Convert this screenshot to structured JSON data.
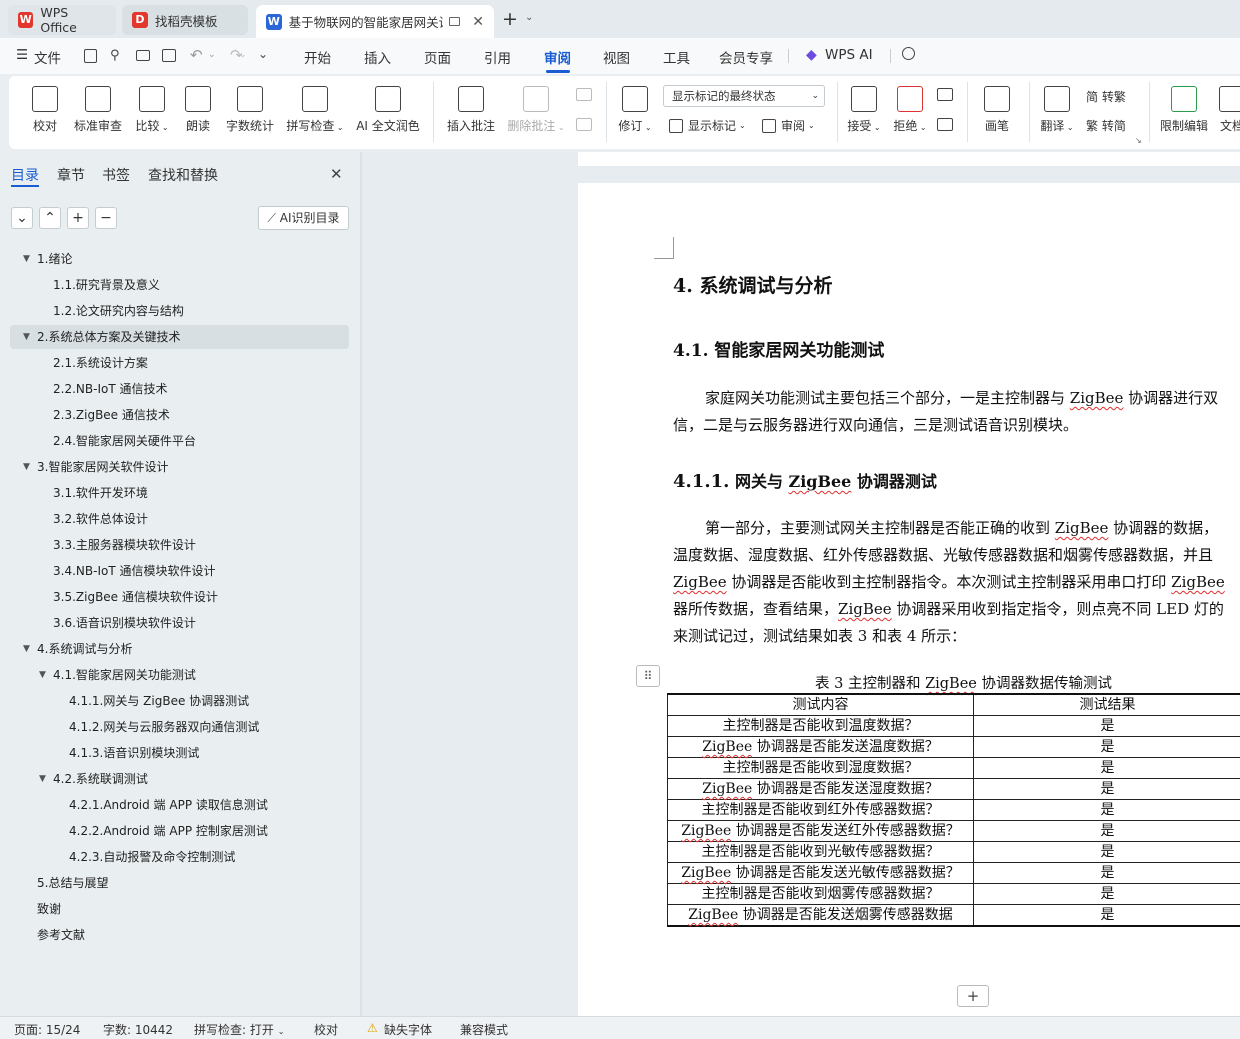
{
  "tabs": [
    {
      "label": "WPS Office",
      "icon": "wps-logo-icon"
    },
    {
      "label": "找稻壳模板",
      "icon": "docer-logo-icon"
    },
    {
      "label": "基于物联网的智能家居网关设",
      "icon": "word-doc-icon"
    }
  ],
  "menu": {
    "file": "文件",
    "items": [
      "开始",
      "插入",
      "页面",
      "引用",
      "审阅",
      "视图",
      "工具",
      "会员专享"
    ],
    "ai": "WPS AI"
  },
  "ribbon": {
    "proofread": "校对",
    "std_review": "标准审查",
    "compare": "比较",
    "read_aloud": "朗读",
    "word_count": "字数统计",
    "spell_check": "拼写检查",
    "ai_polish": "AI 全文润色",
    "insert_comment": "插入批注",
    "delete_comment": "删除批注",
    "revise": "修订",
    "markup_select": "显示标记的最终状态",
    "show_markup": "显示标记",
    "review_pane": "审阅",
    "accept": "接受",
    "reject": "拒绝",
    "pen": "画笔",
    "translate": "翻译",
    "to_trad": "简 转繁",
    "to_simp": "繁 转简",
    "restrict_edit": "限制编辑",
    "doc_rights": "文档"
  },
  "panel": {
    "tabs": [
      "目录",
      "章节",
      "书签",
      "查找和替换"
    ],
    "ai_toc": "AI识别目录",
    "toc": [
      {
        "text": "1.绪论",
        "level": 1,
        "caret": true
      },
      {
        "text": "1.1.研究背景及意义",
        "level": 2
      },
      {
        "text": "1.2.论文研究内容与结构",
        "level": 2
      },
      {
        "text": "2.系统总体方案及关键技术",
        "level": 1,
        "caret": true,
        "selected": true
      },
      {
        "text": "2.1.系统设计方案",
        "level": 2
      },
      {
        "text": "2.2.NB-IoT 通信技术",
        "level": 2
      },
      {
        "text": "2.3.ZigBee 通信技术",
        "level": 2
      },
      {
        "text": "2.4.智能家居网关硬件平台",
        "level": 2
      },
      {
        "text": "3.智能家居网关软件设计",
        "level": 1,
        "caret": true
      },
      {
        "text": "3.1.软件开发环境",
        "level": 2
      },
      {
        "text": "3.2.软件总体设计",
        "level": 2
      },
      {
        "text": "3.3.主服务器模块软件设计",
        "level": 2
      },
      {
        "text": "3.4.NB-IoT 通信模块软件设计",
        "level": 2
      },
      {
        "text": "3.5.ZigBee 通信模块软件设计",
        "level": 2
      },
      {
        "text": "3.6.语音识别模块软件设计",
        "level": 2
      },
      {
        "text": "4.系统调试与分析",
        "level": 1,
        "caret": true
      },
      {
        "text": "4.1.智能家居网关功能测试",
        "level": 2,
        "caret": true
      },
      {
        "text": "4.1.1.网关与 ZigBee 协调器测试",
        "level": 3
      },
      {
        "text": "4.1.2.网关与云服务器双向通信测试",
        "level": 3
      },
      {
        "text": "4.1.3.语音识别模块测试",
        "level": 3
      },
      {
        "text": "4.2.系统联调测试",
        "level": 2,
        "caret": true
      },
      {
        "text": "4.2.1.Android 端 APP 读取信息测试",
        "level": 3
      },
      {
        "text": "4.2.2.Android 端 APP 控制家居测试",
        "level": 3
      },
      {
        "text": "4.2.3.自动报警及命令控制测试",
        "level": 3
      },
      {
        "text": "5.总结与展望",
        "level": 1
      },
      {
        "text": "致谢",
        "level": 1
      },
      {
        "text": "参考文献",
        "level": 1
      }
    ]
  },
  "doc": {
    "h1": "4.  系统调试与分析",
    "h2": "4.1.  智能家居网关功能测试",
    "p1_l1a": "家庭网关功能测试主要包括三个部分，一是主控制器与 ",
    "zig": "ZigBee",
    "p1_l1b": " 协调器进行双",
    "p1_l2": "信，二是与云服务器进行双向通信，三是测试语音识别模块。",
    "h3_num": "4.1.1.",
    "h3_a": "网关与 ",
    "h3_b": " 协调器测试",
    "p2_l1a": "第一部分，主要测试网关主控制器是否能正确的收到 ",
    "p2_l1b": " 协调器的数据，",
    "p2_l2": "温度数据、湿度数据、红外传感器数据、光敏传感器数据和烟雾传感器数据，并且",
    "p2_l3b": "  协调器是否能收到主控制器指令。本次测试主控制器采用串口打印 ",
    "p2_l4a": "器所传数据，查看结果，",
    "p2_l4b": " 协调器采用收到指定指令，则点亮不同 LED 灯的",
    "p2_l5": "来测试记过，测试结果如表 3 和表 4 所示：",
    "caption_a": "表 3  主控制器和 ",
    "caption_b": " 协调器数据传输测试",
    "table": {
      "headers": [
        "测试内容",
        "测试结果"
      ],
      "rows": [
        [
          "主控制器是否能收到温度数据？",
          "是"
        ],
        [
          "ZigBee 协调器是否能发送温度数据？",
          "是"
        ],
        [
          "主控制器是否能收到湿度数据？",
          "是"
        ],
        [
          "ZigBee 协调器是否能发送湿度数据？",
          "是"
        ],
        [
          "主控制器是否能收到红外传感器数据？",
          "是"
        ],
        [
          "ZigBee 协调器是否能发送红外传感器数据？",
          "是"
        ],
        [
          "主控制器是否能收到光敏传感器数据？",
          "是"
        ],
        [
          "ZigBee 协调器是否能发送光敏传感器数据？",
          "是"
        ],
        [
          "主控制器是否能收到烟雾传感器数据？",
          "是"
        ],
        [
          "ZigBee 协调器是否能发送烟雾传感器数据",
          "是"
        ]
      ]
    }
  },
  "status": {
    "page": "页面: 15/24",
    "words": "字数: 10442",
    "spell": "拼写检查: 打开",
    "proof": "校对",
    "missing_font": "缺失字体",
    "compat": "兼容模式"
  },
  "colors": {
    "accent": "#1a5cd1",
    "wps_red": "#e2372d"
  }
}
